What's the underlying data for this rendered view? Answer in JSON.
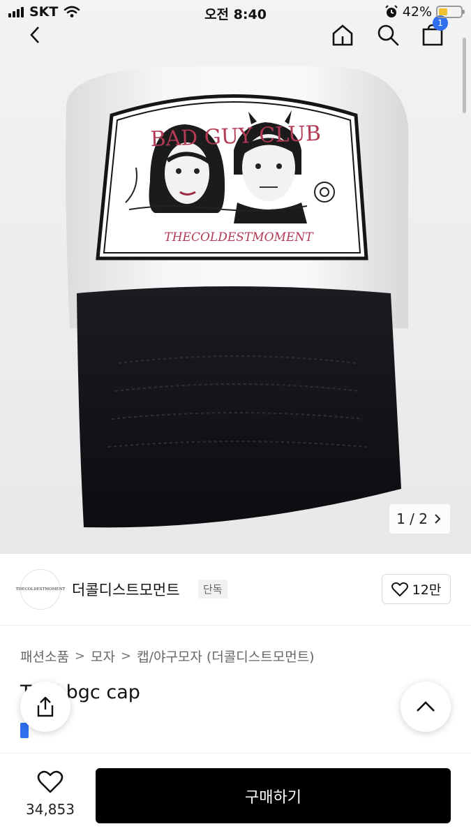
{
  "status_bar": {
    "carrier": "SKT",
    "time": "오전 8:40",
    "battery": "42%",
    "battery_level": 0.42
  },
  "nav": {
    "cart_count": "1"
  },
  "gallery": {
    "pager": "1 / 2",
    "cap_patch_title": "BAD GUY CLUB",
    "cap_patch_subtitle": "THECOLDESTMOMENT"
  },
  "brand": {
    "logo_text": "THECOLDESTMOMENT",
    "name": "더콜디스트모먼트",
    "tag": "단독",
    "likes": "12만"
  },
  "breadcrumb": [
    "패션소품",
    "모자",
    "캡/야구모자 (더콜디스트모먼트)"
  ],
  "product": {
    "title": "TCM bgc cap"
  },
  "bottom_bar": {
    "wish_count": "34,853",
    "buy_label": "구매하기"
  },
  "colors": {
    "accent": "#2f6fed",
    "buy_button": "#000000",
    "patch_red": "#b23a55",
    "battery_fill": "#f0c230"
  }
}
